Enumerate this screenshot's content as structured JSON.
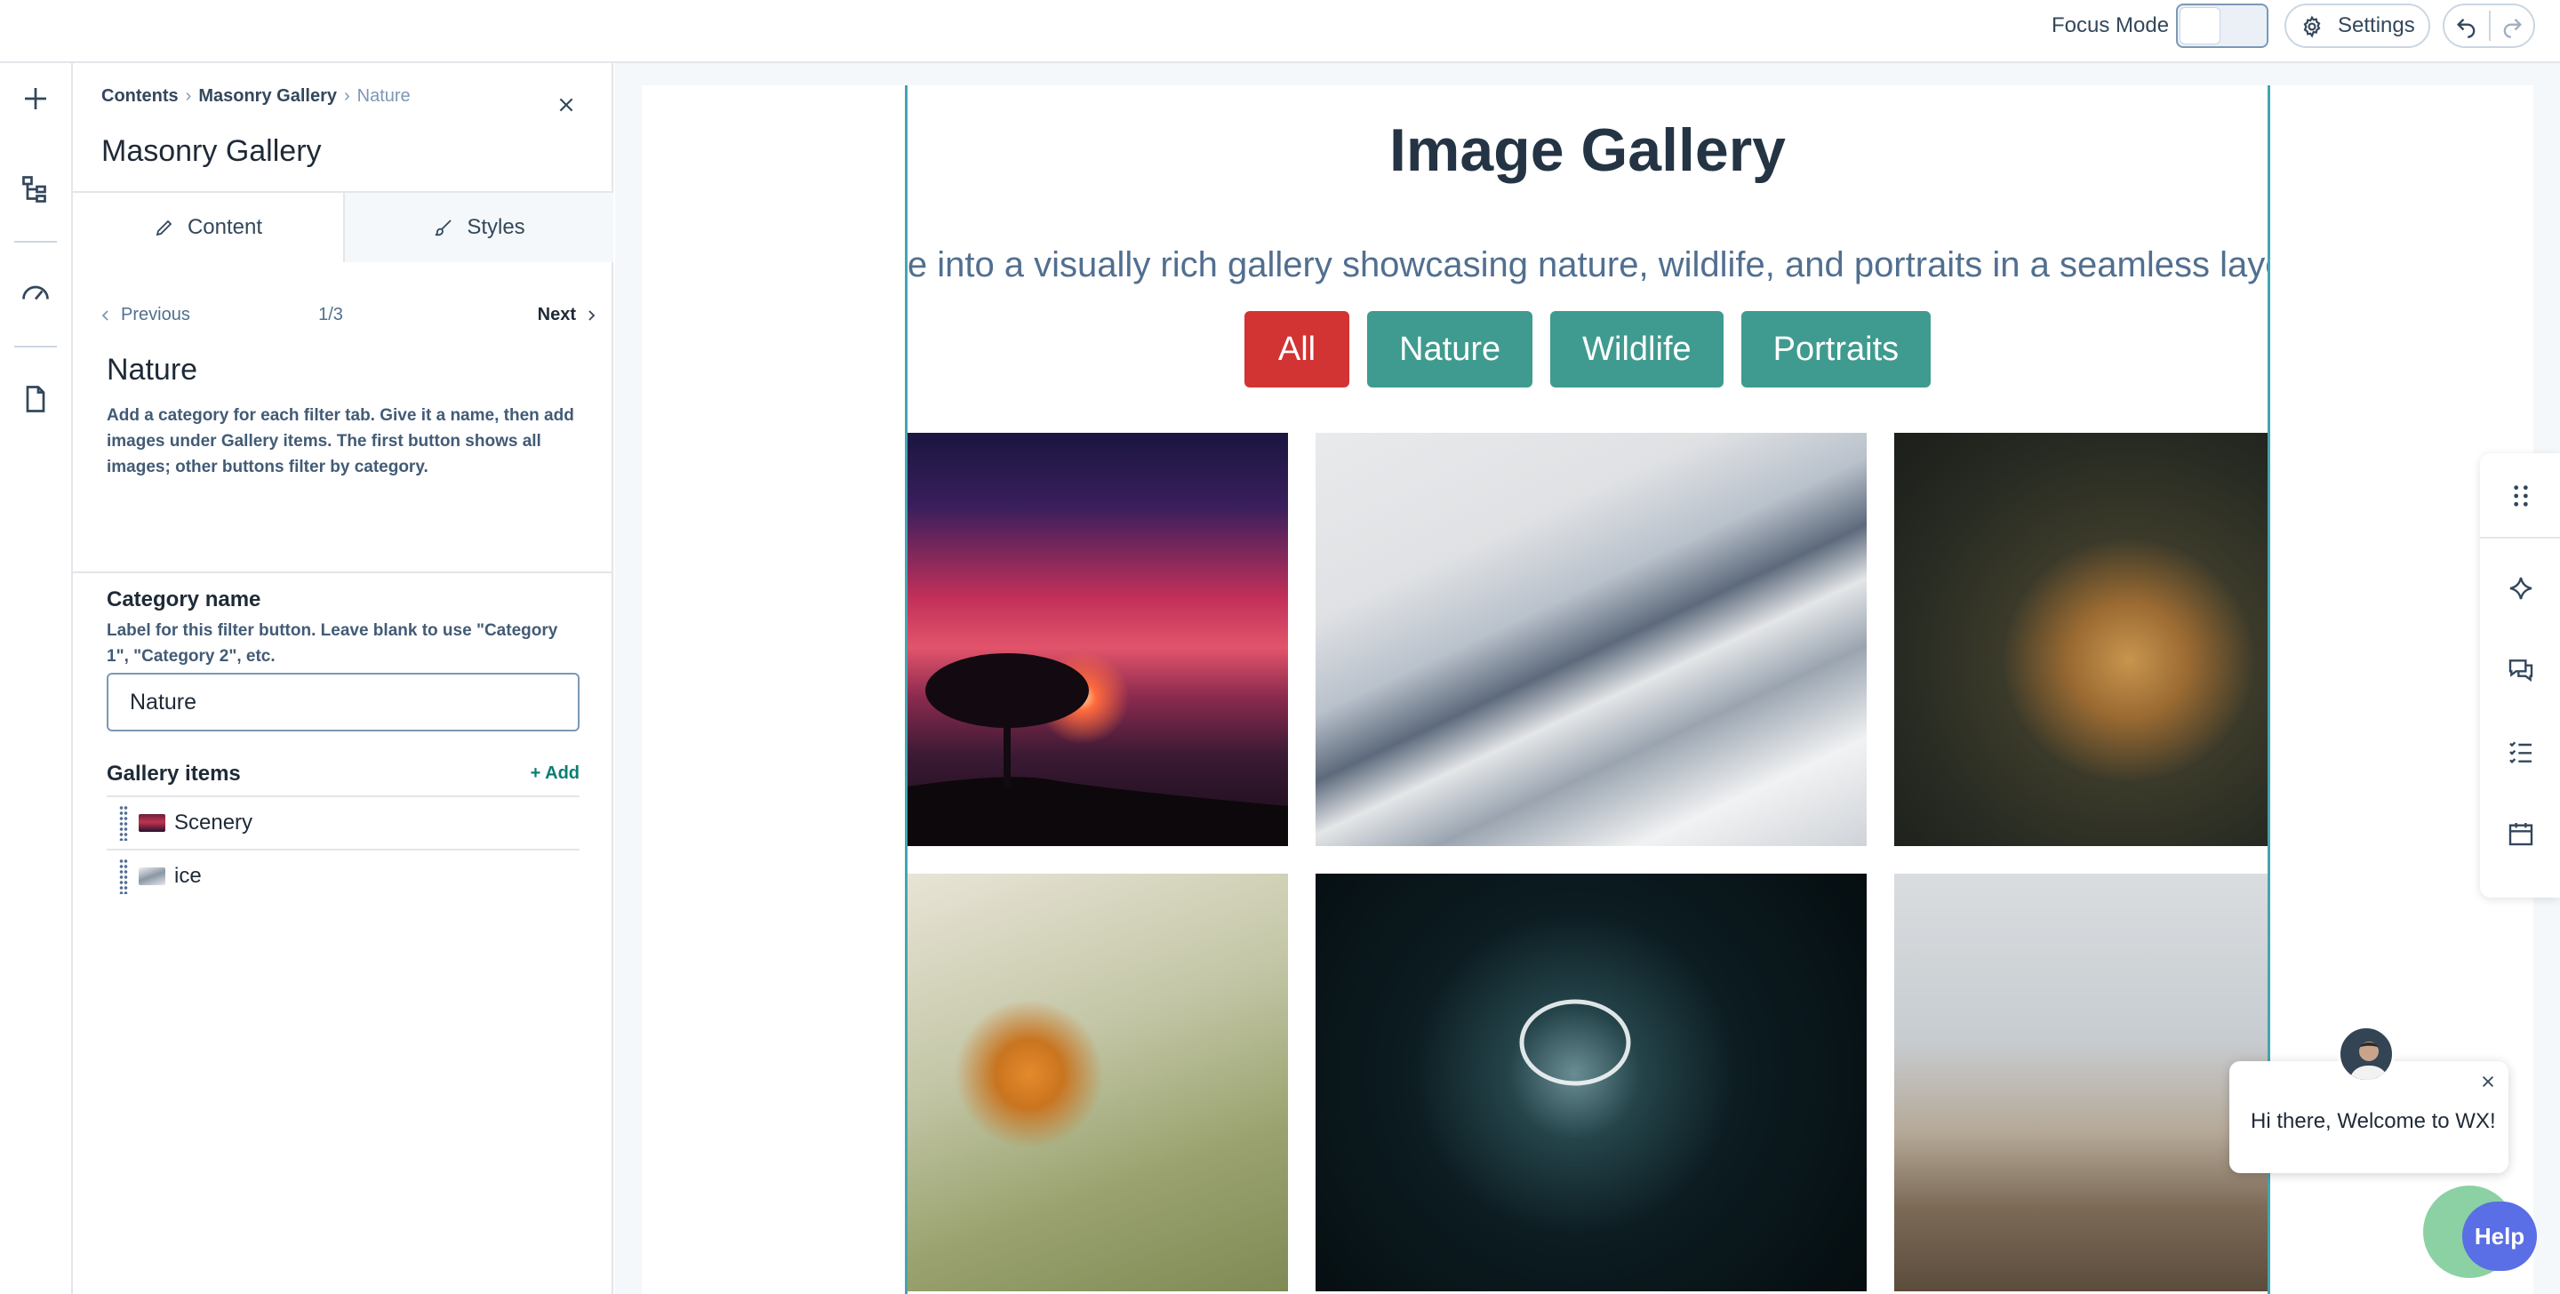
{
  "topbar": {
    "focus_label": "Focus Mode",
    "settings_label": "Settings"
  },
  "panel": {
    "breadcrumb": [
      "Contents",
      "Masonry Gallery",
      "Nature"
    ],
    "title": "Masonry Gallery",
    "tabs": [
      "Content",
      "Styles"
    ],
    "pager": {
      "prev": "Previous",
      "count": "1/3",
      "next": "Next"
    },
    "section_title": "Nature",
    "help_text": "Add a category for each filter tab. Give it a name, then add images under Gallery items. The first button shows all images; other buttons filter by category.",
    "category_label": "Category name",
    "category_help": "Label for this filter button. Leave blank to use \"Category 1\", \"Category 2\", etc.",
    "category_value": "Nature",
    "gallery_items_label": "Gallery items",
    "add_label": "+ Add",
    "gallery_items": [
      "Scenery",
      "ice"
    ]
  },
  "gallery": {
    "title": "Image Gallery",
    "subtitle": "Dive into a visually rich gallery showcasing nature, wildlife, and portraits in a seamless layout.",
    "filters": [
      "All",
      "Nature",
      "Wildlife",
      "Portraits"
    ],
    "active_filter": "All",
    "photos": [
      "sunset-tree",
      "snowy-mountain",
      "cheetah",
      "robin",
      "light-ring-portrait",
      "photographer-pier"
    ]
  },
  "chat": {
    "message": "Hi there, Welcome to WX!",
    "help_label": "Help"
  },
  "colors": {
    "accent": "#3f9b8f",
    "active_filter": "#d23333",
    "frame": "#42a5b2",
    "help": "#5a6ee6"
  }
}
